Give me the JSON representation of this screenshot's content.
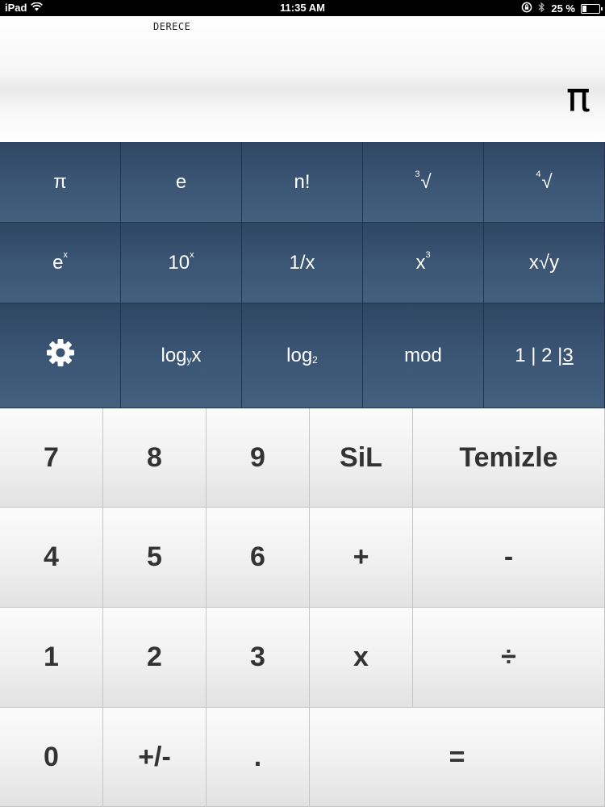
{
  "status_bar": {
    "device": "iPad",
    "time": "11:35 AM",
    "battery": "25 %",
    "battery_level": 0.25
  },
  "display": {
    "mode": "DERECE",
    "value": "π"
  },
  "scientific_keys": [
    {
      "id": "pi",
      "label": "π"
    },
    {
      "id": "e",
      "label": "e"
    },
    {
      "id": "factorial",
      "label": "n!"
    },
    {
      "id": "cube-root",
      "pre": "3",
      "label": "√"
    },
    {
      "id": "fourth-root",
      "pre": "4",
      "label": "√"
    },
    {
      "id": "e-power",
      "label": "e",
      "sup": "x"
    },
    {
      "id": "ten-power",
      "label": "10",
      "sup": "x"
    },
    {
      "id": "reciprocal",
      "label": "1/x"
    },
    {
      "id": "cube",
      "label": "x",
      "sup": "3"
    },
    {
      "id": "x-root-y",
      "label": "x√y"
    },
    {
      "id": "settings",
      "icon": "gear-icon"
    },
    {
      "id": "log-base-y",
      "label_a": "log",
      "sub": "y",
      "label_b": "x"
    },
    {
      "id": "log-base-2",
      "label_a": "log",
      "sub": "2"
    },
    {
      "id": "mod",
      "label": "mod"
    },
    {
      "id": "page-indicator",
      "label_a": "1 | 2 |",
      "label_b": "3"
    }
  ],
  "keypad": {
    "row1": [
      "7",
      "8",
      "9",
      "SiL",
      "Temizle"
    ],
    "row2": [
      "4",
      "5",
      "6",
      "+",
      "-"
    ],
    "row3": [
      "1",
      "2",
      "3",
      "x",
      "÷"
    ],
    "row4": [
      "0",
      "+/-",
      ".",
      "="
    ]
  }
}
